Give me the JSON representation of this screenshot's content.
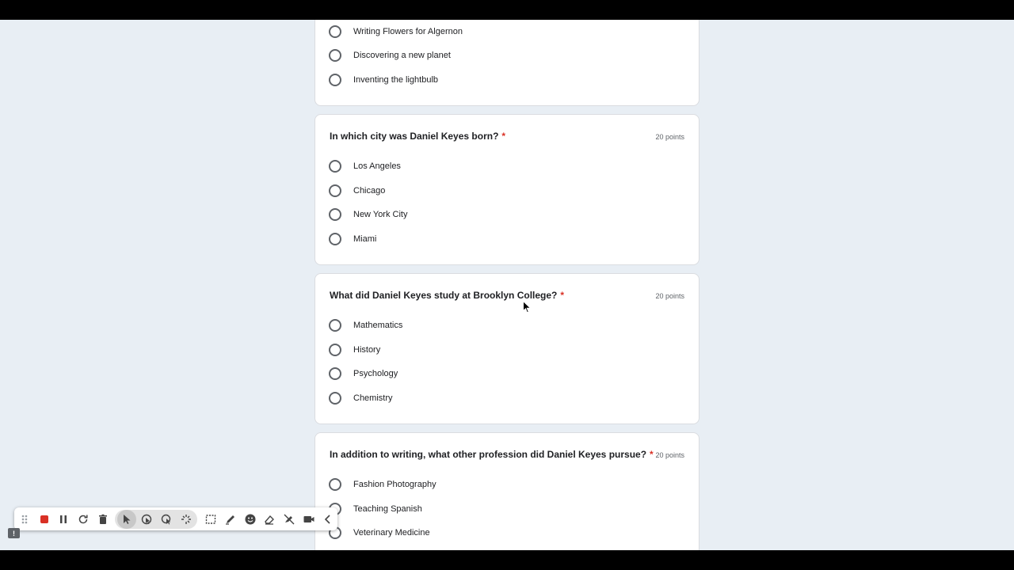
{
  "quiz": {
    "card0": {
      "options": [
        "Writing Flowers for Algernon",
        "Discovering a new planet",
        "Inventing the lightbulb"
      ]
    },
    "card1": {
      "question": "In which city was Daniel Keyes born?",
      "required_mark": "*",
      "points": "20 points",
      "options": [
        "Los Angeles",
        "Chicago",
        "New York City",
        "Miami"
      ]
    },
    "card2": {
      "question": "What did Daniel Keyes study at Brooklyn College?",
      "required_mark": "*",
      "points": "20 points",
      "options": [
        "Mathematics",
        "History",
        "Psychology",
        "Chemistry"
      ]
    },
    "card3": {
      "question": "In addition to writing, what other profession did Daniel Keyes pursue?",
      "required_mark": "*",
      "points": "20 points",
      "options": [
        "Fashion Photography",
        "Teaching Spanish",
        "Veterinary Medicine"
      ]
    }
  },
  "toolbar": {
    "icons": [
      "drag-handle-icon",
      "stop-record-icon",
      "pause-icon",
      "restart-icon",
      "delete-icon",
      "pointer-icon",
      "click-highlight-icon",
      "spotlight-icon",
      "laser-icon",
      "select-area-icon",
      "pen-icon",
      "emoji-icon",
      "eraser-icon",
      "hide-annotations-icon",
      "camera-icon",
      "collapse-icon"
    ]
  },
  "colors": {
    "required": "#d93025",
    "record": "#d93025",
    "page_bg": "#e8eef4"
  }
}
